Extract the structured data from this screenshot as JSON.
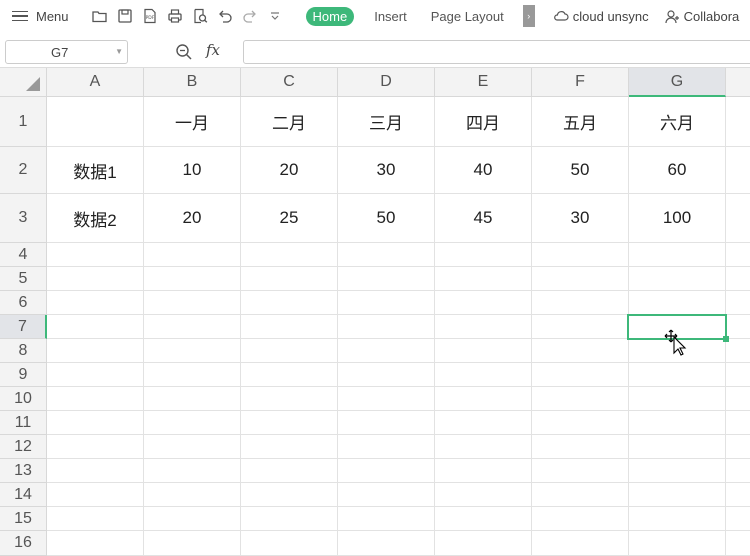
{
  "toolbar": {
    "menu_label": "Menu",
    "tabs": [
      "Home",
      "Insert",
      "Page Layout"
    ],
    "cloud_label": "cloud unsync",
    "collab_label": "Collabora"
  },
  "formula_bar": {
    "cell_ref": "G7",
    "formula": ""
  },
  "sheet": {
    "columns": [
      "A",
      "B",
      "C",
      "D",
      "E",
      "F",
      "G"
    ],
    "rows": [
      "1",
      "2",
      "3",
      "4",
      "5",
      "6",
      "7",
      "8",
      "9",
      "10",
      "11",
      "12",
      "13",
      "14",
      "15",
      "16"
    ],
    "selected_cell": "G7",
    "cells": {
      "B1": "一月",
      "C1": "二月",
      "D1": "三月",
      "E1": "四月",
      "F1": "五月",
      "G1": "六月",
      "A2": "数据1",
      "B2": "10",
      "C2": "20",
      "D2": "30",
      "E2": "40",
      "F2": "50",
      "G2": "60",
      "A3": "数据2",
      "B3": "20",
      "C3": "25",
      "D3": "50",
      "E3": "45",
      "F3": "30",
      "G3": "100"
    }
  },
  "colors": {
    "accent": "#3db87a",
    "header_bg": "#f3f3f3",
    "selected_header_bg": "#e2e4e8"
  }
}
